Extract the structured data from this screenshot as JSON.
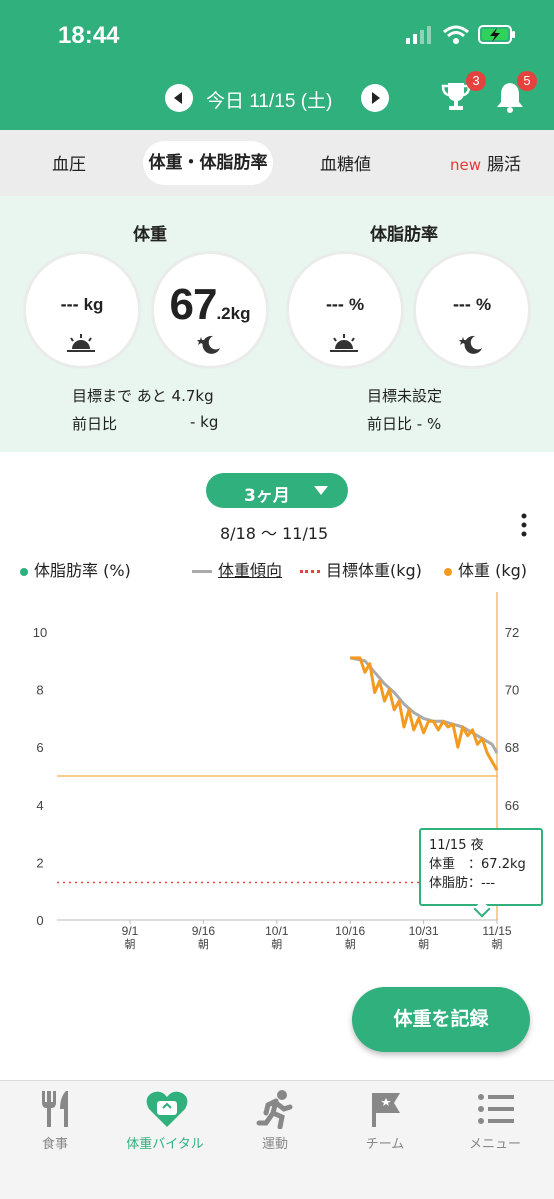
{
  "status": {
    "time": "18:44"
  },
  "nav": {
    "date": "今日 11/15 (土)"
  },
  "badges": {
    "trophy": "3",
    "bell": "5"
  },
  "tabs": [
    {
      "label": "血圧"
    },
    {
      "label": "体重・体脂肪率"
    },
    {
      "label": "血糖値"
    },
    {
      "label_new": "new",
      "label": "腸活"
    }
  ],
  "summary": {
    "weight_title": "体重",
    "bodyfat_title": "体脂肪率",
    "morning_weight": "---",
    "weight_unit": "kg",
    "evening_weight_int": "67",
    "evening_weight_dec": ".2",
    "evening_weight_unit": "kg",
    "morning_fat": "---",
    "evening_fat": "---",
    "fat_unit": "%",
    "goal_remaining": "目標まで あと 4.7kg",
    "weight_diff_label": "前日比",
    "weight_diff_value": "- kg",
    "fat_goal": "目標未設定",
    "fat_diff": "前日比 - %"
  },
  "chart_controls": {
    "range": "3ヶ月",
    "period": "8/18 〜 11/15"
  },
  "legend": {
    "bodyfat": "体脂肪率 (%)",
    "trend": "体重傾向",
    "target": "目標体重(kg)",
    "weight": "体重 (kg)"
  },
  "colors": {
    "accent": "#2fb07d",
    "weight": "#f39a1f",
    "trend": "#aaaaaa",
    "target": "#e3463c",
    "bodyfat": "#2fb07d"
  },
  "chart_data": {
    "type": "line",
    "left_axis": {
      "ticks": [
        "0",
        "2",
        "4",
        "6",
        "8",
        "10"
      ],
      "range": [
        0,
        10
      ]
    },
    "right_axis": {
      "ticks": [
        "66",
        "68",
        "70",
        "72"
      ],
      "range": [
        62,
        72
      ]
    },
    "x_ticks": [
      {
        "date": "9/1",
        "sub": "朝"
      },
      {
        "date": "9/16",
        "sub": "朝"
      },
      {
        "date": "10/1",
        "sub": "朝"
      },
      {
        "date": "10/16",
        "sub": "朝"
      },
      {
        "date": "10/31",
        "sub": "朝"
      },
      {
        "date": "11/15",
        "sub": "朝"
      }
    ],
    "target_weight": 67.0,
    "series": [
      {
        "name": "体重 (kg)",
        "x": [
          "10/16",
          "10/18",
          "10/19",
          "10/20",
          "10/21",
          "10/22",
          "10/23",
          "10/24",
          "10/25",
          "10/26",
          "10/27",
          "10/28",
          "10/29",
          "10/30",
          "10/31",
          "11/1",
          "11/2",
          "11/3",
          "11/4",
          "11/5",
          "11/6",
          "11/7",
          "11/8",
          "11/9",
          "11/10",
          "11/11",
          "11/12",
          "11/13",
          "11/14",
          "11/15"
        ],
        "values": [
          71.1,
          71.1,
          70.6,
          70.9,
          69.9,
          70.3,
          69.6,
          70.0,
          69.3,
          69.6,
          68.7,
          69.3,
          68.6,
          69.0,
          68.5,
          68.9,
          68.9,
          68.6,
          68.9,
          68.7,
          68.8,
          68.0,
          68.7,
          68.4,
          68.6,
          68.1,
          68.3,
          67.8,
          67.5,
          67.2
        ]
      },
      {
        "name": "体重傾向",
        "x": [
          "10/16",
          "10/19",
          "10/21",
          "10/23",
          "10/25",
          "10/27",
          "10/29",
          "10/31",
          "11/2",
          "11/4",
          "11/6",
          "11/8",
          "11/10",
          "11/12",
          "11/14",
          "11/15"
        ],
        "values": [
          71.1,
          71.0,
          70.6,
          70.2,
          69.9,
          69.5,
          69.2,
          69.0,
          68.9,
          68.9,
          68.8,
          68.7,
          68.5,
          68.3,
          68.1,
          67.8
        ]
      }
    ]
  },
  "tooltip": {
    "title": "11/15 夜",
    "weight_label": "体重",
    "weight_value": "：67.2kg",
    "fat_label": "体脂肪",
    "fat_value": "：---"
  },
  "record_button": "体重を記録",
  "bottom_nav": [
    {
      "label": "食事"
    },
    {
      "label": "体重バイタル"
    },
    {
      "label": "運動"
    },
    {
      "label": "チーム"
    },
    {
      "label": "メニュー"
    }
  ]
}
